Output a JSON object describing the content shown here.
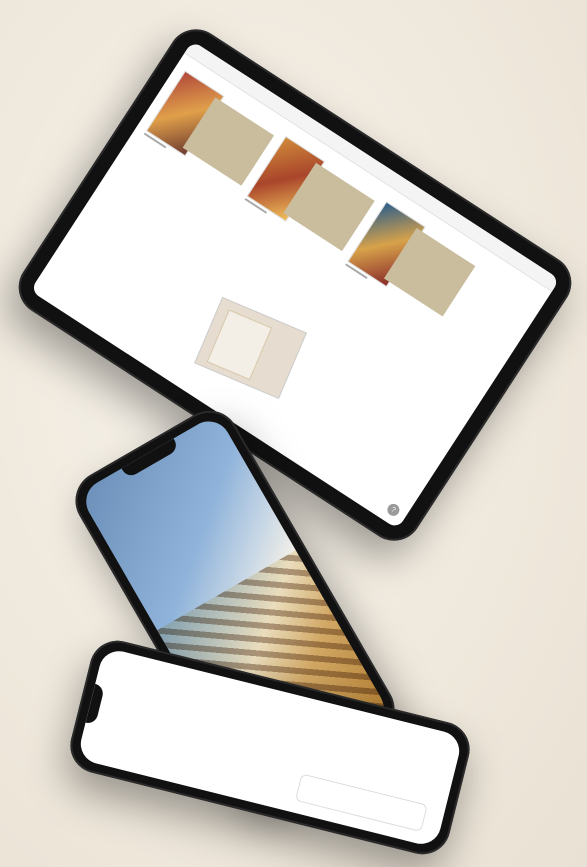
{
  "scene": {
    "background_color": "#efe8dc",
    "accent_color": "#c23a55"
  },
  "tablet": {
    "status": "",
    "title": "",
    "cards": [
      {
        "caption": "",
        "button": ""
      },
      {
        "caption": "",
        "button": ""
      },
      {
        "caption": "",
        "button": ""
      }
    ],
    "footer": "",
    "help_icon": "?"
  },
  "phone_photo": {
    "subject": ""
  },
  "phone_bottom": {
    "lines": [
      "",
      "",
      ""
    ],
    "panel_text": ""
  }
}
